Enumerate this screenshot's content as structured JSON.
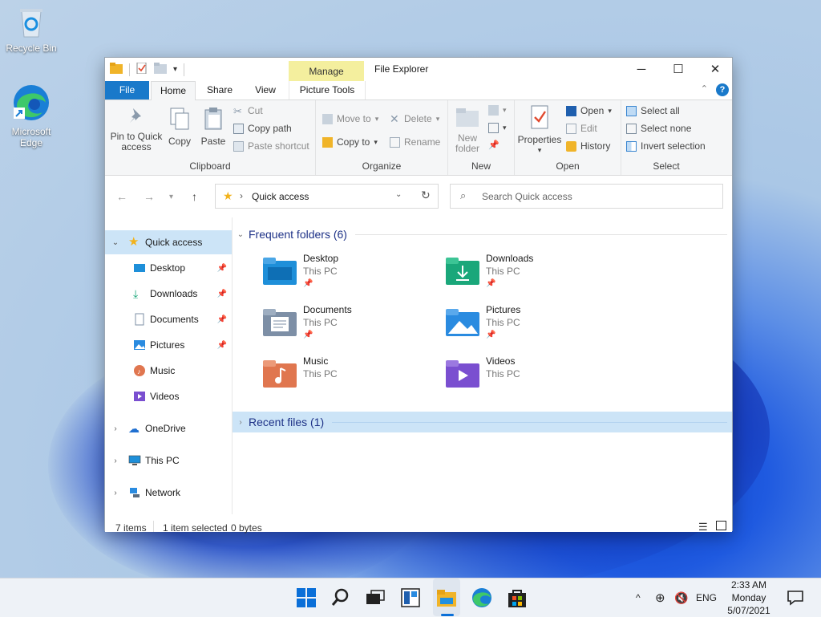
{
  "desktop": {
    "icons": [
      {
        "label": "Recycle Bin"
      },
      {
        "label": "Microsoft Edge"
      }
    ]
  },
  "window": {
    "title": "File Explorer",
    "context_tab_group": "Manage",
    "controls": {
      "minimize": "─",
      "maximize": "☐",
      "close": "✕"
    }
  },
  "tabs": {
    "file": "File",
    "home": "Home",
    "share": "Share",
    "view": "View",
    "picture_tools": "Picture Tools",
    "collapse": "⌃",
    "help": "?"
  },
  "ribbon": {
    "clipboard": {
      "label": "Clipboard",
      "pin": "Pin to Quick access",
      "copy": "Copy",
      "paste": "Paste",
      "cut": "Cut",
      "copy_path": "Copy path",
      "paste_shortcut": "Paste shortcut"
    },
    "organize": {
      "label": "Organize",
      "move_to": "Move to",
      "copy_to": "Copy to",
      "delete": "Delete",
      "rename": "Rename"
    },
    "new": {
      "label": "New",
      "new_folder": "New folder"
    },
    "open": {
      "label": "Open",
      "properties": "Properties",
      "open": "Open",
      "edit": "Edit",
      "history": "History"
    },
    "select": {
      "label": "Select",
      "select_all": "Select all",
      "select_none": "Select none",
      "invert": "Invert selection"
    }
  },
  "navbar": {
    "path_separator": "›",
    "path": "Quick access",
    "search_placeholder": "Search Quick access"
  },
  "sidebar": {
    "items": [
      {
        "label": "Quick access",
        "selected": true
      },
      {
        "label": "Desktop",
        "pinned": true
      },
      {
        "label": "Downloads",
        "pinned": true
      },
      {
        "label": "Documents",
        "pinned": true
      },
      {
        "label": "Pictures",
        "pinned": true
      },
      {
        "label": "Music"
      },
      {
        "label": "Videos"
      },
      {
        "label": "OneDrive"
      },
      {
        "label": "This PC"
      },
      {
        "label": "Network"
      }
    ]
  },
  "content": {
    "frequent_header": "Frequent folders (6)",
    "recent_header": "Recent files (1)",
    "folders": [
      {
        "name": "Desktop",
        "location": "This PC",
        "color": "#1e8fd9"
      },
      {
        "name": "Downloads",
        "location": "This PC",
        "color": "#1aa77a"
      },
      {
        "name": "Documents",
        "location": "This PC",
        "color": "#7d8fa6"
      },
      {
        "name": "Pictures",
        "location": "This PC",
        "color": "#2a8be0"
      },
      {
        "name": "Music",
        "location": "This PC",
        "color": "#e0764f"
      },
      {
        "name": "Videos",
        "location": "This PC",
        "color": "#7a4fd0"
      }
    ]
  },
  "status": {
    "items": "7 items",
    "selection": "1 item selected",
    "size": "0 bytes"
  },
  "taskbar": {
    "tray": {
      "language": "ENG",
      "chevron": "^"
    },
    "clock": {
      "time": "2:33 AM",
      "day": "Monday",
      "date": "5/07/2021"
    }
  },
  "colors": {
    "accent": "#1979ca",
    "manage_tab": "#f4ef9e",
    "selected_row": "#cce4f7",
    "section_header": "#1e3287"
  }
}
